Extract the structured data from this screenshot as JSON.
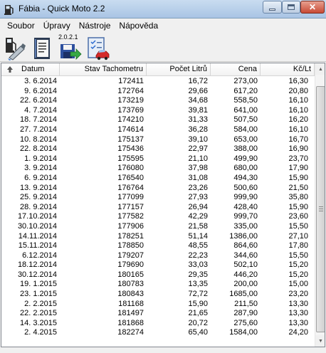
{
  "window": {
    "title": "Fábia - Quick Moto 2.2"
  },
  "menu": {
    "items": [
      "Soubor",
      "Úpravy",
      "Nástroje",
      "Nápověda"
    ]
  },
  "toolbar": {
    "version_label": "2.0.2.1"
  },
  "columns": [
    "Datum",
    "Stav Tachometru",
    "Počet Litrů",
    "Cena",
    "Kč/Lt"
  ],
  "rows": [
    [
      "3.  6.2014",
      "172411",
      "16,72",
      "273,00",
      "16,30"
    ],
    [
      "9.  6.2014",
      "172764",
      "29,66",
      "617,20",
      "20,80"
    ],
    [
      "22.  6.2014",
      "173219",
      "34,68",
      "558,50",
      "16,10"
    ],
    [
      "4.  7.2014",
      "173769",
      "39,81",
      "641,00",
      "16,10"
    ],
    [
      "18.  7.2014",
      "174210",
      "31,33",
      "507,50",
      "16,20"
    ],
    [
      "27.  7.2014",
      "174614",
      "36,28",
      "584,00",
      "16,10"
    ],
    [
      "10.  8.2014",
      "175137",
      "39,10",
      "653,00",
      "16,70"
    ],
    [
      "22.  8.2014",
      "175436",
      "22,97",
      "388,00",
      "16,90"
    ],
    [
      "1.  9.2014",
      "175595",
      "21,10",
      "499,90",
      "23,70"
    ],
    [
      "3.  9.2014",
      "176080",
      "37,98",
      "680,00",
      "17,90"
    ],
    [
      "6.  9.2014",
      "176540",
      "31,08",
      "494,30",
      "15,90"
    ],
    [
      "13.  9.2014",
      "176764",
      "23,26",
      "500,60",
      "21,50"
    ],
    [
      "25.  9.2014",
      "177099",
      "27,93",
      "999,90",
      "35,80"
    ],
    [
      "28.  9.2014",
      "177157",
      "26,94",
      "428,40",
      "15,90"
    ],
    [
      "17.10.2014",
      "177582",
      "42,29",
      "999,70",
      "23,60"
    ],
    [
      "30.10.2014",
      "177906",
      "21,58",
      "335,00",
      "15,50"
    ],
    [
      "14.11.2014",
      "178251",
      "51,14",
      "1386,00",
      "27,10"
    ],
    [
      "15.11.2014",
      "178850",
      "48,55",
      "864,60",
      "17,80"
    ],
    [
      "6.12.2014",
      "179207",
      "22,23",
      "344,60",
      "15,50"
    ],
    [
      "18.12.2014",
      "179690",
      "33,03",
      "502,10",
      "15,20"
    ],
    [
      "30.12.2014",
      "180165",
      "29,35",
      "446,20",
      "15,20"
    ],
    [
      "19.  1.2015",
      "180783",
      "13,35",
      "200,00",
      "15,00"
    ],
    [
      "23.  1.2015",
      "180843",
      "72,72",
      "1685,00",
      "23,20"
    ],
    [
      "2.  2.2015",
      "181168",
      "15,90",
      "211,50",
      "13,30"
    ],
    [
      "22.  2.2015",
      "181497",
      "21,65",
      "287,90",
      "13,30"
    ],
    [
      "14.  3.2015",
      "181868",
      "20,72",
      "275,60",
      "13,30"
    ],
    [
      "2.  4.2015",
      "182274",
      "65,40",
      "1584,00",
      "24,20"
    ]
  ]
}
